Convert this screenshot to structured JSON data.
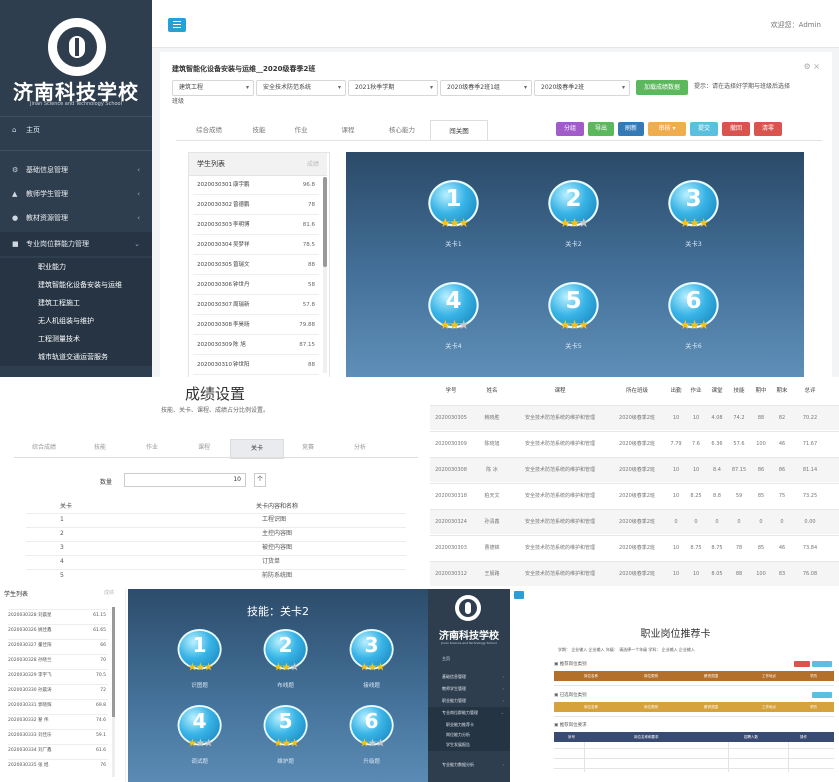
{
  "school": {
    "name": "济南科技学校",
    "name_en": "Jinan Science and Technology School"
  },
  "main": {
    "topbar": {
      "user": "欢迎您：Admin"
    },
    "sidebar": {
      "home": "主页",
      "items": [
        {
          "label": "基础信息管理",
          "icon": "cog-icon"
        },
        {
          "label": "教师学生管理",
          "icon": "user-icon"
        },
        {
          "label": "教材资源管理",
          "icon": "globe-icon"
        },
        {
          "label": "专业岗位群能力管理",
          "icon": "folder-icon"
        }
      ],
      "subitems": [
        "职业能力",
        "建筑智能化设备安装与运维",
        "建筑工程施工",
        "无人机组装与维护",
        "工程测量技术",
        "城市轨道交通运营服务"
      ]
    },
    "page_title": "建筑智能化设备安装与运维__2020级春季2班",
    "selects": [
      "建筑工程",
      "安全技术防范系统",
      "2021秋季学期",
      "2020级春季2班1组",
      "2020级春季2班"
    ],
    "query_button": "加载成绩数据",
    "tip": "提示：请在选择好学期与班级后选择",
    "tip2": "班级",
    "tabs": [
      "综合成绩",
      "技能",
      "作业",
      "课程",
      "核心能力",
      "闯关图"
    ],
    "actions": [
      {
        "label": "分组",
        "color": "#a15cc9"
      },
      {
        "label": "导出",
        "color": "#5cb85c"
      },
      {
        "label": "刷新",
        "color": "#337ab7"
      },
      {
        "label": "审核 ▾",
        "color": "#f0ad4e"
      },
      {
        "label": "提交",
        "color": "#5bc0de"
      },
      {
        "label": "撤回",
        "color": "#d9534f"
      },
      {
        "label": "清零",
        "color": "#d9534f"
      }
    ],
    "student_list": {
      "title": "学生列表",
      "label": "成绩",
      "rows": [
        {
          "id": "2020030301",
          "name": "康宇鹏",
          "score": "96.8"
        },
        {
          "id": "2020030302",
          "name": "曾德鹏",
          "score": "78"
        },
        {
          "id": "2020030303",
          "name": "李明博",
          "score": "81.6"
        },
        {
          "id": "2020030304",
          "name": "吴梦祥",
          "score": "78.5"
        },
        {
          "id": "2020030305",
          "name": "曾瑞文",
          "score": "88"
        },
        {
          "id": "2020030306",
          "name": "钟世丹",
          "score": "58"
        },
        {
          "id": "2020030307",
          "name": "周瑞新",
          "score": "57.8"
        },
        {
          "id": "2020030308",
          "name": "李昊旸",
          "score": "79.88"
        },
        {
          "id": "2020030309",
          "name": "陈 旭",
          "score": "87.15"
        },
        {
          "id": "2020030310",
          "name": "钟世阳",
          "score": "88"
        }
      ]
    },
    "levels": [
      {
        "n": "1",
        "label": "关卡1",
        "stars": 3
      },
      {
        "n": "2",
        "label": "关卡2",
        "stars": 2
      },
      {
        "n": "3",
        "label": "关卡3",
        "stars": 3
      },
      {
        "n": "4",
        "label": "关卡4",
        "stars": 2
      },
      {
        "n": "5",
        "label": "关卡5",
        "stars": 3
      },
      {
        "n": "6",
        "label": "关卡6",
        "stars": 3
      }
    ]
  },
  "settings": {
    "title": "成绩设置",
    "subtitle": "技能、关卡、课程、成绩占分比例设置。",
    "tabs": [
      "综合成绩",
      "技能",
      "作业",
      "课程",
      "关卡",
      "竞赛",
      "分析"
    ],
    "qty_label": "数量",
    "qty_value": "10",
    "qty_unit": "个",
    "col_level": "关卡",
    "col_name": "关卡内容和名称",
    "rows": [
      {
        "n": "1",
        "name": "工程识图"
      },
      {
        "n": "2",
        "name": "主控内容图"
      },
      {
        "n": "3",
        "name": "被控内容图"
      },
      {
        "n": "4",
        "name": "订货单"
      },
      {
        "n": "5",
        "name": "前防系统图"
      }
    ]
  },
  "score_table": {
    "headers": [
      "学号",
      "姓名",
      "课程",
      "所在班级",
      "出勤",
      "作业",
      "课堂",
      "技能",
      "期中",
      "期末",
      "总评"
    ],
    "rows": [
      [
        "2020030305",
        "韩晓胜",
        "安全技术防范系统的维护和管理",
        "2020级春季2班",
        "10",
        "10",
        "4.08",
        "74.2",
        "88",
        "82",
        "70.22"
      ],
      [
        "2020030309",
        "陈晓旭",
        "安全技术防范系统的维护和管理",
        "2020级春季2班",
        "7.79",
        "7.6",
        "6.36",
        "57.6",
        "100",
        "46",
        "71.67"
      ],
      [
        "2020030308",
        "陈 冰",
        "安全技术防范系统的维护和管理",
        "2020级春季2班",
        "10",
        "10",
        "8.4",
        "87.15",
        "86",
        "86",
        "81.14"
      ],
      [
        "2020030318",
        "柏天文",
        "安全技术防范系统的维护和管理",
        "2020级春季2班",
        "10",
        "8.25",
        "8.8",
        "59",
        "85",
        "75",
        "73.25"
      ],
      [
        "2020030324",
        "孙清鑫",
        "安全技术防范系统的维护和管理",
        "2020级春季2班",
        "0",
        "0",
        "0",
        "0",
        "0",
        "0",
        "0.00"
      ],
      [
        "2020030303",
        "曹德锦",
        "安全技术防范系统的维护和管理",
        "2020级春季2班",
        "10",
        "8.75",
        "8.75",
        "78",
        "85",
        "46",
        "73.84"
      ],
      [
        "2020030312",
        "王晨路",
        "安全技术防范系统的维护和管理",
        "2020级春季2班",
        "10",
        "10",
        "8.05",
        "88",
        "100",
        "83",
        "76.08"
      ]
    ]
  },
  "mini_list": {
    "title": "学生列表",
    "label": "成绩",
    "rows": [
      {
        "name": "2020030328 刘晨星",
        "score": "61.15"
      },
      {
        "name": "2020030326 姚佳鑫",
        "score": "61.65"
      },
      {
        "name": "2020030327 董佳阳",
        "score": "66"
      },
      {
        "name": "2020030328 孙晓兰",
        "score": "70"
      },
      {
        "name": "2020030329 李宇飞",
        "score": "70.5"
      },
      {
        "name": "2020030330 孙晨涛",
        "score": "72"
      },
      {
        "name": "2020030331 郭晓辉",
        "score": "69.8"
      },
      {
        "name": "2020030332 翟 伟",
        "score": "74.6"
      },
      {
        "name": "2020030333 刘佳乐",
        "score": "59.1"
      },
      {
        "name": "2020030334 刘广鑫",
        "score": "61.6"
      },
      {
        "name": "2020030335 张 旭",
        "score": "76"
      }
    ]
  },
  "stage2": {
    "title": "技能：关卡2",
    "levels": [
      {
        "n": "1",
        "label": "识图题",
        "stars": 3
      },
      {
        "n": "2",
        "label": "布线题",
        "stars": 2
      },
      {
        "n": "3",
        "label": "接线题",
        "stars": 3
      },
      {
        "n": "4",
        "label": "调试题",
        "stars": 1
      },
      {
        "n": "5",
        "label": "维护题",
        "stars": 3
      },
      {
        "n": "6",
        "label": "升级题",
        "stars": 1
      }
    ]
  },
  "jobs": {
    "title": "职业岗位推荐卡",
    "filter": "学期：  企业输入   企业输入     年级：  请选择一个年级          学科：  企业输入   企业输入",
    "sections": [
      "推荐岗位类别",
      "已选岗位类别",
      "推荐岗位要求"
    ],
    "bar_cols": [
      "岗位名称",
      "岗位类别",
      "薪资范围",
      "工作地点",
      "学历"
    ],
    "table_cols": [
      "序号",
      "岗位名称和要求",
      "招聘人数",
      "操作"
    ],
    "side_items": [
      "主页",
      "基础信息管理",
      "教师学生管理",
      "职业能力管理",
      "专业岗位群能力管理"
    ],
    "side_subs": [
      "职业能力推荐卡",
      "岗位能力分析",
      "学生发展报告"
    ],
    "side_last": "专业能力数据分析"
  }
}
